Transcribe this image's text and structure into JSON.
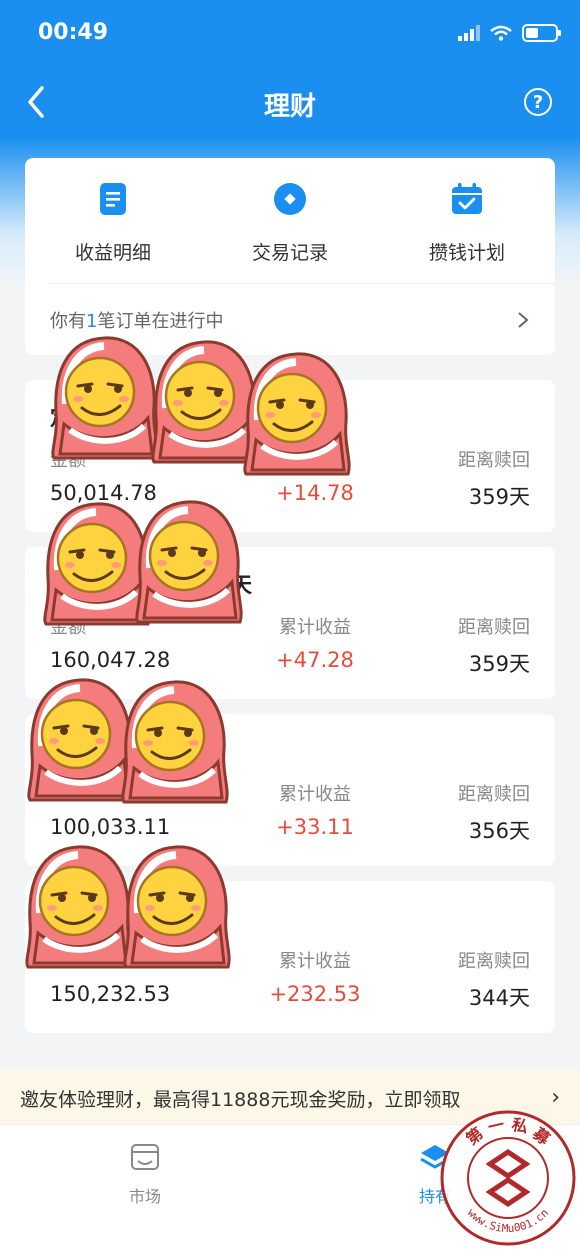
{
  "status_bar": {
    "time": "00:49"
  },
  "header": {
    "title": "理财",
    "help_icon": "question-circle-icon",
    "back_icon": "chevron-left-icon"
  },
  "menu": {
    "items": [
      {
        "label": "收益明细",
        "icon": "document-icon"
      },
      {
        "label": "交易记录",
        "icon": "record-icon"
      },
      {
        "label": "攒钱计划",
        "icon": "calendar-check-icon"
      }
    ],
    "order_prefix": "你有",
    "order_count": "1",
    "order_suffix": "笔订单在进行中"
  },
  "holdings": [
    {
      "name": "定",
      "amount_label": "金额",
      "amount": "50,014.78",
      "profit_label": "",
      "profit": "+14.78",
      "redeem_label": "距离赎回",
      "redeem_days": "359天"
    },
    {
      "name": "天",
      "amount_label": "金额",
      "amount": "160,047.28",
      "profit_label": "累计收益",
      "profit": "+47.28",
      "redeem_label": "距离赎回",
      "redeem_days": "359天"
    },
    {
      "name": "",
      "amount_label": "",
      "amount": "100,033.11",
      "profit_label": "累计收益",
      "profit": "+33.11",
      "redeem_label": "距离赎回",
      "redeem_days": "356天"
    },
    {
      "name": "",
      "amount_label": "",
      "amount": "150,232.53",
      "profit_label": "累计收益",
      "profit": "+232.53",
      "redeem_label": "距离赎回",
      "redeem_days": "344天"
    }
  ],
  "promo": {
    "text": "邀友体验理财，最高得11888元现金奖励，立即领取"
  },
  "tabbar": {
    "items": [
      {
        "label": "市场",
        "icon": "store-icon"
      },
      {
        "label": "持有",
        "icon": "layers-icon"
      }
    ]
  },
  "watermark": {
    "text": "第 一 私 募",
    "url": "www.SiMu001.cn"
  },
  "colors": {
    "primary": "#1b8ff0",
    "profit": "#e84b3a",
    "promo_bg": "#fdf7e8"
  }
}
